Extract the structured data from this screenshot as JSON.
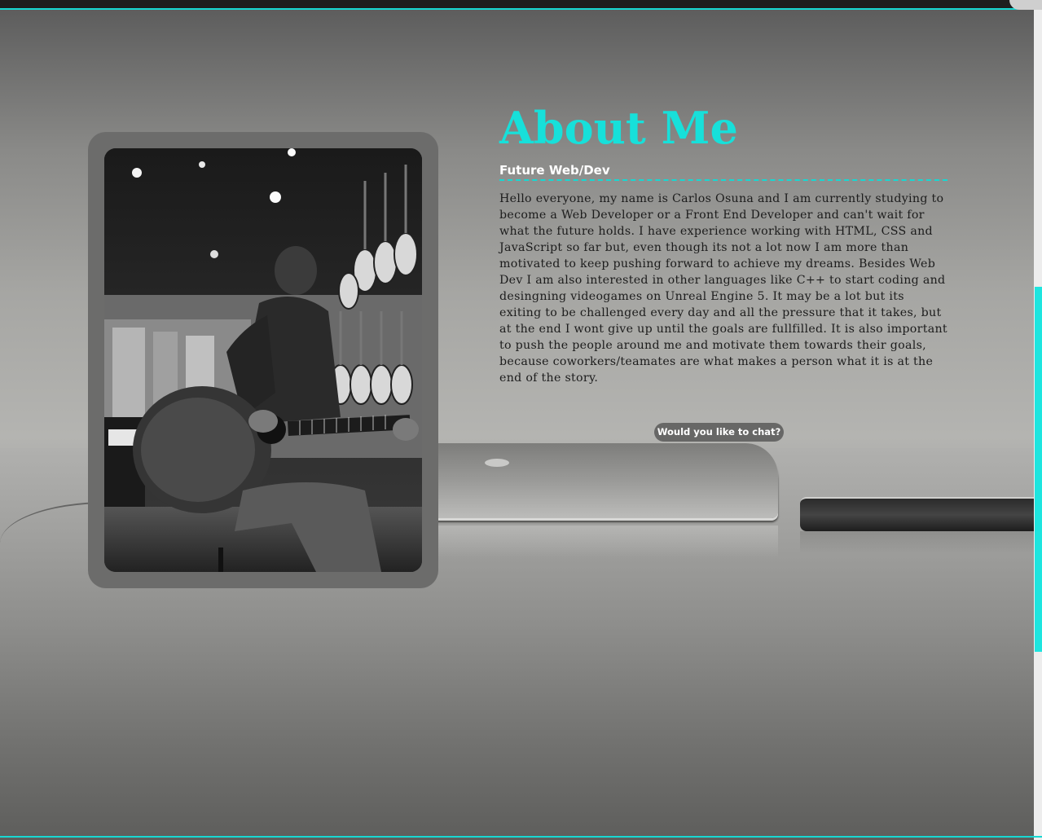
{
  "about": {
    "title": "About Me",
    "subtitle": "Future Web/Dev",
    "bio": "Hello everyone, my name is Carlos Osuna and I am currently studying to become a Web Developer or a Front End Developer and can't wait for what the future holds. I have experience working with HTML, CSS and JavaScript so far but, even though its not a lot now I am more than motivated to keep pushing forward to achieve my dreams. Besides Web Dev I am also interested in other languages like C++ to start coding and desingning videogames on Unreal Engine 5. It may be a lot but its exiting to be challenged every day and all the pressure that it takes, but at the end I wont give up until the goals are fullfilled. It is also important to push the people around me and motivate them towards their goals, because coworkers/teamates are what makes a person what it is at the end of the story.",
    "chat_button": "Would you like to chat?"
  },
  "photo": {
    "subject": "person playing acoustic guitar in guitar store"
  },
  "colors": {
    "accent": "#17e0da",
    "frame": "#6c6c6b",
    "button_bg": "#676766",
    "text": "#1c1c1c"
  }
}
